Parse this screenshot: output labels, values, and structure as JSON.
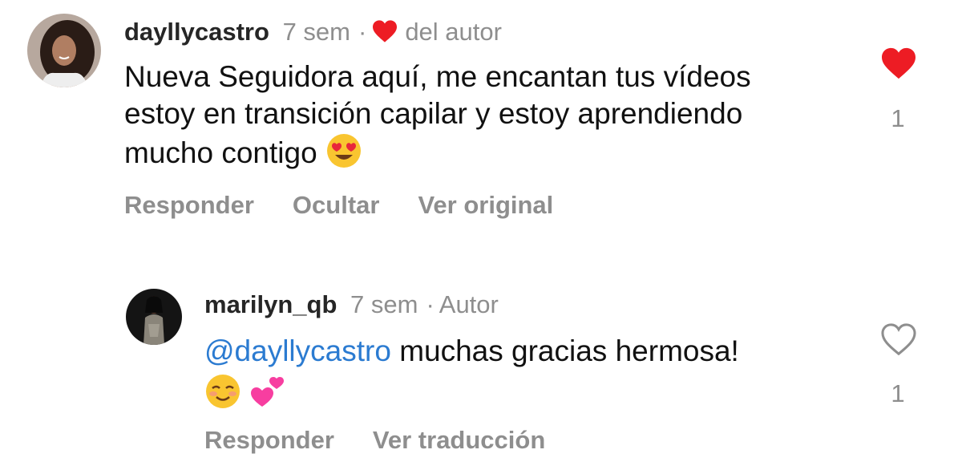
{
  "comments": [
    {
      "username": "dayllycastro",
      "time": "7 sem",
      "separator": "·",
      "badge": "del autor",
      "badge_icon": "heart-icon",
      "text_lines": [
        "Nueva Seguidora aquí, me encantan tus vídeos",
        "estoy en transición capilar y estoy aprendiendo",
        "mucho contigo"
      ],
      "emoji": "heart-eyes-emoji",
      "actions": [
        "Responder",
        "Ocultar",
        "Ver original"
      ],
      "liked": true,
      "like_count": "1"
    },
    {
      "username": "marilyn_qb",
      "time": "7 sem",
      "separator": "·",
      "badge": "Autor",
      "mention": "@dayllycastro",
      "text": " muchas gracias hermosa!",
      "emojis": [
        "smiling-emoji",
        "two-hearts-emoji"
      ],
      "actions": [
        "Responder",
        "Ver traducción"
      ],
      "liked": false,
      "like_count": "1"
    }
  ],
  "colors": {
    "like_red": "#ed1c24",
    "mention_blue": "#2b7bd1",
    "muted_gray": "#8e8e8e"
  }
}
